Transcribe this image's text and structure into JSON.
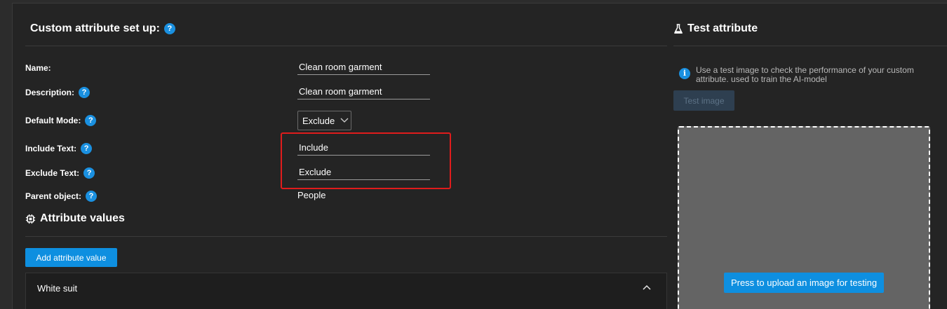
{
  "setup": {
    "title": "Custom attribute set up:",
    "fields": {
      "name": {
        "label": "Name:",
        "value": "Clean room garment"
      },
      "description": {
        "label": "Description:",
        "value": "Clean room garment"
      },
      "default_mode": {
        "label": "Default Mode:",
        "selected": "Exclude"
      },
      "include_text": {
        "label": "Include Text:",
        "value": "Include"
      },
      "exclude_text": {
        "label": "Exclude Text:",
        "value": "Exclude"
      },
      "parent_object": {
        "label": "Parent object:",
        "value": "People"
      }
    }
  },
  "attribute_values": {
    "title": "Attribute values",
    "add_button": "Add attribute value",
    "items": [
      {
        "label": "White suit"
      }
    ]
  },
  "test": {
    "title": "Test attribute",
    "info": "Use a test image to check the performance of your custom attribute. used to train the AI-model",
    "test_button": "Test image",
    "upload_button": "Press to upload an image for testing"
  },
  "colors": {
    "accent": "#0e8fe0",
    "highlight": "#e01c1c",
    "panel": "#242424",
    "dropzone": "#646464"
  },
  "icons": {
    "help": "question-circle-icon",
    "info": "info-circle-icon",
    "chip": "chip-icon",
    "flask": "flask-icon",
    "select_arrow": "chevron-down-icon",
    "collapse": "chevron-up-icon"
  }
}
